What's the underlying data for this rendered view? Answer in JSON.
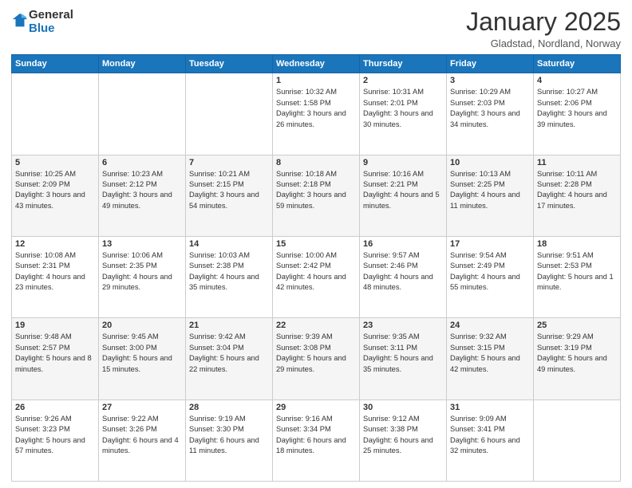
{
  "header": {
    "logo_line1": "General",
    "logo_line2": "Blue",
    "month_title": "January 2025",
    "location": "Gladstad, Nordland, Norway"
  },
  "weekdays": [
    "Sunday",
    "Monday",
    "Tuesday",
    "Wednesday",
    "Thursday",
    "Friday",
    "Saturday"
  ],
  "weeks": [
    [
      {
        "day": "",
        "sunrise": "",
        "sunset": "",
        "daylight": ""
      },
      {
        "day": "",
        "sunrise": "",
        "sunset": "",
        "daylight": ""
      },
      {
        "day": "",
        "sunrise": "",
        "sunset": "",
        "daylight": ""
      },
      {
        "day": "1",
        "sunrise": "Sunrise: 10:32 AM",
        "sunset": "Sunset: 1:58 PM",
        "daylight": "Daylight: 3 hours and 26 minutes."
      },
      {
        "day": "2",
        "sunrise": "Sunrise: 10:31 AM",
        "sunset": "Sunset: 2:01 PM",
        "daylight": "Daylight: 3 hours and 30 minutes."
      },
      {
        "day": "3",
        "sunrise": "Sunrise: 10:29 AM",
        "sunset": "Sunset: 2:03 PM",
        "daylight": "Daylight: 3 hours and 34 minutes."
      },
      {
        "day": "4",
        "sunrise": "Sunrise: 10:27 AM",
        "sunset": "Sunset: 2:06 PM",
        "daylight": "Daylight: 3 hours and 39 minutes."
      }
    ],
    [
      {
        "day": "5",
        "sunrise": "Sunrise: 10:25 AM",
        "sunset": "Sunset: 2:09 PM",
        "daylight": "Daylight: 3 hours and 43 minutes."
      },
      {
        "day": "6",
        "sunrise": "Sunrise: 10:23 AM",
        "sunset": "Sunset: 2:12 PM",
        "daylight": "Daylight: 3 hours and 49 minutes."
      },
      {
        "day": "7",
        "sunrise": "Sunrise: 10:21 AM",
        "sunset": "Sunset: 2:15 PM",
        "daylight": "Daylight: 3 hours and 54 minutes."
      },
      {
        "day": "8",
        "sunrise": "Sunrise: 10:18 AM",
        "sunset": "Sunset: 2:18 PM",
        "daylight": "Daylight: 3 hours and 59 minutes."
      },
      {
        "day": "9",
        "sunrise": "Sunrise: 10:16 AM",
        "sunset": "Sunset: 2:21 PM",
        "daylight": "Daylight: 4 hours and 5 minutes."
      },
      {
        "day": "10",
        "sunrise": "Sunrise: 10:13 AM",
        "sunset": "Sunset: 2:25 PM",
        "daylight": "Daylight: 4 hours and 11 minutes."
      },
      {
        "day": "11",
        "sunrise": "Sunrise: 10:11 AM",
        "sunset": "Sunset: 2:28 PM",
        "daylight": "Daylight: 4 hours and 17 minutes."
      }
    ],
    [
      {
        "day": "12",
        "sunrise": "Sunrise: 10:08 AM",
        "sunset": "Sunset: 2:31 PM",
        "daylight": "Daylight: 4 hours and 23 minutes."
      },
      {
        "day": "13",
        "sunrise": "Sunrise: 10:06 AM",
        "sunset": "Sunset: 2:35 PM",
        "daylight": "Daylight: 4 hours and 29 minutes."
      },
      {
        "day": "14",
        "sunrise": "Sunrise: 10:03 AM",
        "sunset": "Sunset: 2:38 PM",
        "daylight": "Daylight: 4 hours and 35 minutes."
      },
      {
        "day": "15",
        "sunrise": "Sunrise: 10:00 AM",
        "sunset": "Sunset: 2:42 PM",
        "daylight": "Daylight: 4 hours and 42 minutes."
      },
      {
        "day": "16",
        "sunrise": "Sunrise: 9:57 AM",
        "sunset": "Sunset: 2:46 PM",
        "daylight": "Daylight: 4 hours and 48 minutes."
      },
      {
        "day": "17",
        "sunrise": "Sunrise: 9:54 AM",
        "sunset": "Sunset: 2:49 PM",
        "daylight": "Daylight: 4 hours and 55 minutes."
      },
      {
        "day": "18",
        "sunrise": "Sunrise: 9:51 AM",
        "sunset": "Sunset: 2:53 PM",
        "daylight": "Daylight: 5 hours and 1 minute."
      }
    ],
    [
      {
        "day": "19",
        "sunrise": "Sunrise: 9:48 AM",
        "sunset": "Sunset: 2:57 PM",
        "daylight": "Daylight: 5 hours and 8 minutes."
      },
      {
        "day": "20",
        "sunrise": "Sunrise: 9:45 AM",
        "sunset": "Sunset: 3:00 PM",
        "daylight": "Daylight: 5 hours and 15 minutes."
      },
      {
        "day": "21",
        "sunrise": "Sunrise: 9:42 AM",
        "sunset": "Sunset: 3:04 PM",
        "daylight": "Daylight: 5 hours and 22 minutes."
      },
      {
        "day": "22",
        "sunrise": "Sunrise: 9:39 AM",
        "sunset": "Sunset: 3:08 PM",
        "daylight": "Daylight: 5 hours and 29 minutes."
      },
      {
        "day": "23",
        "sunrise": "Sunrise: 9:35 AM",
        "sunset": "Sunset: 3:11 PM",
        "daylight": "Daylight: 5 hours and 35 minutes."
      },
      {
        "day": "24",
        "sunrise": "Sunrise: 9:32 AM",
        "sunset": "Sunset: 3:15 PM",
        "daylight": "Daylight: 5 hours and 42 minutes."
      },
      {
        "day": "25",
        "sunrise": "Sunrise: 9:29 AM",
        "sunset": "Sunset: 3:19 PM",
        "daylight": "Daylight: 5 hours and 49 minutes."
      }
    ],
    [
      {
        "day": "26",
        "sunrise": "Sunrise: 9:26 AM",
        "sunset": "Sunset: 3:23 PM",
        "daylight": "Daylight: 5 hours and 57 minutes."
      },
      {
        "day": "27",
        "sunrise": "Sunrise: 9:22 AM",
        "sunset": "Sunset: 3:26 PM",
        "daylight": "Daylight: 6 hours and 4 minutes."
      },
      {
        "day": "28",
        "sunrise": "Sunrise: 9:19 AM",
        "sunset": "Sunset: 3:30 PM",
        "daylight": "Daylight: 6 hours and 11 minutes."
      },
      {
        "day": "29",
        "sunrise": "Sunrise: 9:16 AM",
        "sunset": "Sunset: 3:34 PM",
        "daylight": "Daylight: 6 hours and 18 minutes."
      },
      {
        "day": "30",
        "sunrise": "Sunrise: 9:12 AM",
        "sunset": "Sunset: 3:38 PM",
        "daylight": "Daylight: 6 hours and 25 minutes."
      },
      {
        "day": "31",
        "sunrise": "Sunrise: 9:09 AM",
        "sunset": "Sunset: 3:41 PM",
        "daylight": "Daylight: 6 hours and 32 minutes."
      },
      {
        "day": "",
        "sunrise": "",
        "sunset": "",
        "daylight": ""
      }
    ]
  ]
}
